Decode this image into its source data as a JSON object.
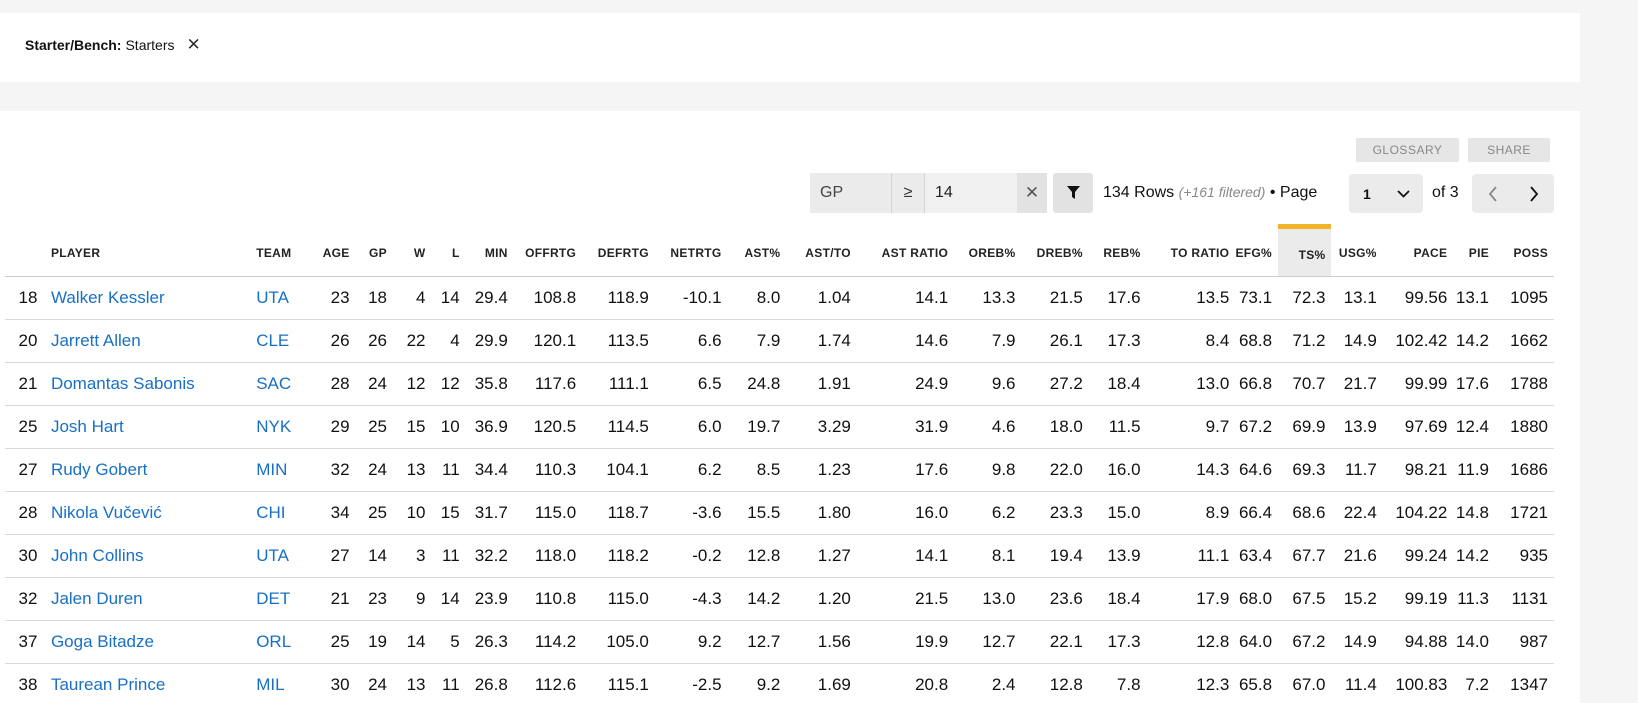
{
  "filter_chip": {
    "key": "Starter/Bench:",
    "value": "Starters",
    "remove_icon": "close-icon"
  },
  "toolbar": {
    "glossary_label": "GLOSSARY",
    "share_label": "SHARE"
  },
  "filter": {
    "field": "GP",
    "operator": "≥",
    "value": "14",
    "clear_icon": "close-icon",
    "apply_icon": "funnel-icon"
  },
  "rows_info": {
    "rows": "134 Rows",
    "filtered": "(+161 filtered)",
    "page_label": "• Page",
    "page_value": "1",
    "of_label": "of 3"
  },
  "colors": {
    "link": "#1870c4",
    "sort_accent": "#f0b429",
    "panel": "#ffffff",
    "background": "#f5f5f5"
  },
  "table": {
    "sorted_column": "TS%",
    "columns": [
      "",
      "PLAYER",
      "TEAM",
      "AGE",
      "GP",
      "W",
      "L",
      "MIN",
      "OFFRTG",
      "DEFRTG",
      "NETRTG",
      "AST%",
      "AST/TO",
      "AST RATIO",
      "OREB%",
      "DREB%",
      "REB%",
      "TO RATIO",
      "EFG%",
      "TS%",
      "USG%",
      "PACE",
      "PIE",
      "POSS"
    ],
    "rows": [
      [
        "18",
        "Walker Kessler",
        "UTA",
        "23",
        "18",
        "4",
        "14",
        "29.4",
        "108.8",
        "118.9",
        "-10.1",
        "8.0",
        "1.04",
        "14.1",
        "13.3",
        "21.5",
        "17.6",
        "13.5",
        "73.1",
        "72.3",
        "13.1",
        "99.56",
        "13.1",
        "1095"
      ],
      [
        "20",
        "Jarrett Allen",
        "CLE",
        "26",
        "26",
        "22",
        "4",
        "29.9",
        "120.1",
        "113.5",
        "6.6",
        "7.9",
        "1.74",
        "14.6",
        "7.9",
        "26.1",
        "17.3",
        "8.4",
        "68.8",
        "71.2",
        "14.9",
        "102.42",
        "14.2",
        "1662"
      ],
      [
        "21",
        "Domantas Sabonis",
        "SAC",
        "28",
        "24",
        "12",
        "12",
        "35.8",
        "117.6",
        "111.1",
        "6.5",
        "24.8",
        "1.91",
        "24.9",
        "9.6",
        "27.2",
        "18.4",
        "13.0",
        "66.8",
        "70.7",
        "21.7",
        "99.99",
        "17.6",
        "1788"
      ],
      [
        "25",
        "Josh Hart",
        "NYK",
        "29",
        "25",
        "15",
        "10",
        "36.9",
        "120.5",
        "114.5",
        "6.0",
        "19.7",
        "3.29",
        "31.9",
        "4.6",
        "18.0",
        "11.5",
        "9.7",
        "67.2",
        "69.9",
        "13.9",
        "97.69",
        "12.4",
        "1880"
      ],
      [
        "27",
        "Rudy Gobert",
        "MIN",
        "32",
        "24",
        "13",
        "11",
        "34.4",
        "110.3",
        "104.1",
        "6.2",
        "8.5",
        "1.23",
        "17.6",
        "9.8",
        "22.0",
        "16.0",
        "14.3",
        "64.6",
        "69.3",
        "11.7",
        "98.21",
        "11.9",
        "1686"
      ],
      [
        "28",
        "Nikola Vučević",
        "CHI",
        "34",
        "25",
        "10",
        "15",
        "31.7",
        "115.0",
        "118.7",
        "-3.6",
        "15.5",
        "1.80",
        "16.0",
        "6.2",
        "23.3",
        "15.0",
        "8.9",
        "66.4",
        "68.6",
        "22.4",
        "104.22",
        "14.8",
        "1721"
      ],
      [
        "30",
        "John Collins",
        "UTA",
        "27",
        "14",
        "3",
        "11",
        "32.2",
        "118.0",
        "118.2",
        "-0.2",
        "12.8",
        "1.27",
        "14.1",
        "8.1",
        "19.4",
        "13.9",
        "11.1",
        "63.4",
        "67.7",
        "21.6",
        "99.24",
        "14.2",
        "935"
      ],
      [
        "32",
        "Jalen Duren",
        "DET",
        "21",
        "23",
        "9",
        "14",
        "23.9",
        "110.8",
        "115.0",
        "-4.3",
        "14.2",
        "1.20",
        "21.5",
        "13.0",
        "23.6",
        "18.4",
        "17.9",
        "68.0",
        "67.5",
        "15.2",
        "99.19",
        "11.3",
        "1131"
      ],
      [
        "37",
        "Goga Bitadze",
        "ORL",
        "25",
        "19",
        "14",
        "5",
        "26.3",
        "114.2",
        "105.0",
        "9.2",
        "12.7",
        "1.56",
        "19.9",
        "12.7",
        "22.1",
        "17.3",
        "12.8",
        "64.0",
        "67.2",
        "14.9",
        "94.88",
        "14.0",
        "987"
      ],
      [
        "38",
        "Taurean Prince",
        "MIL",
        "30",
        "24",
        "13",
        "11",
        "26.8",
        "112.6",
        "115.1",
        "-2.5",
        "9.2",
        "1.69",
        "20.8",
        "2.4",
        "12.8",
        "7.8",
        "12.3",
        "65.8",
        "67.0",
        "11.4",
        "100.83",
        "7.2",
        "1347"
      ]
    ]
  }
}
